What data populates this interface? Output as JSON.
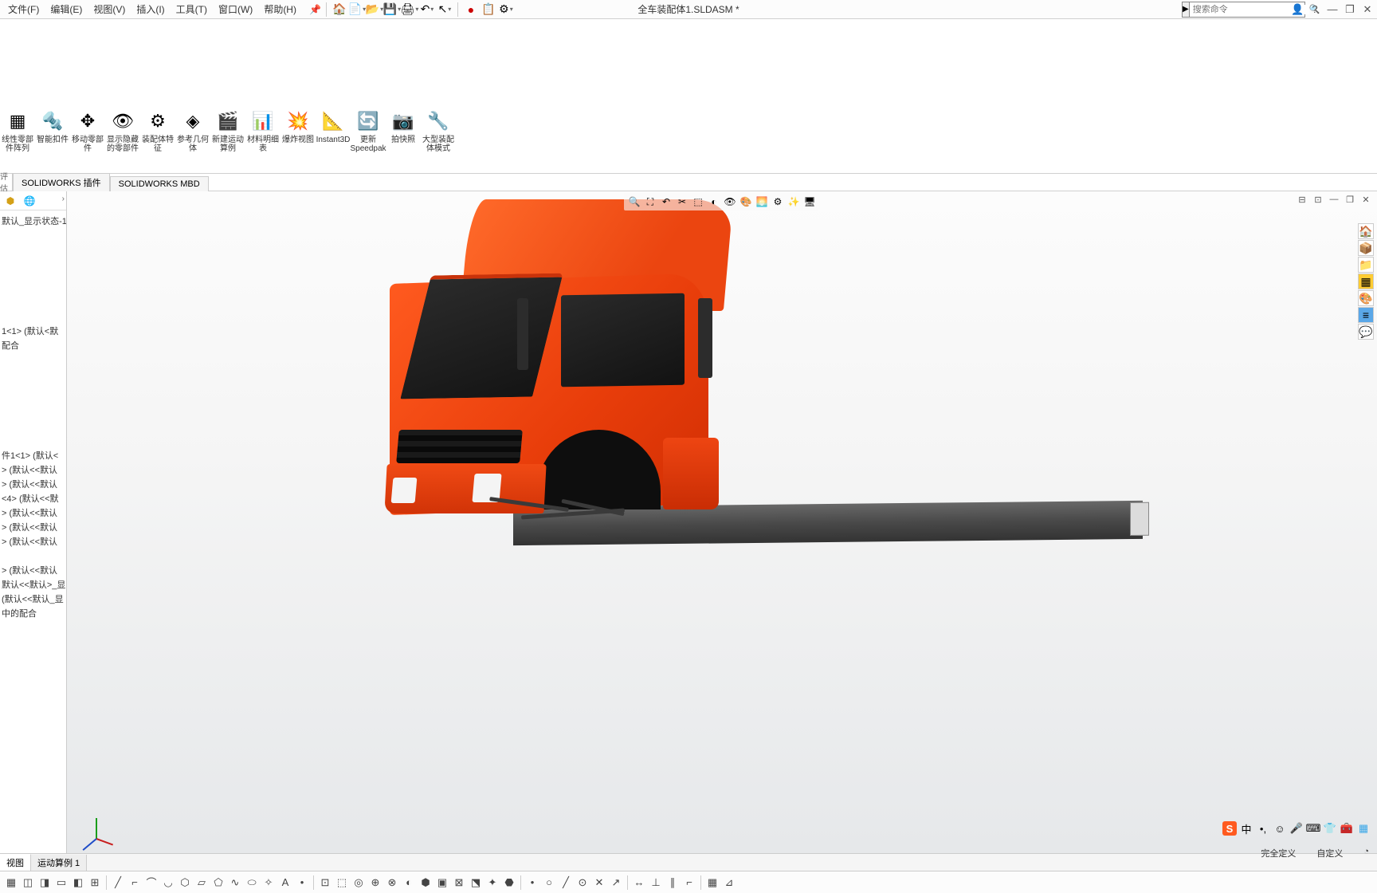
{
  "menu": {
    "items": [
      "文件(F)",
      "编辑(E)",
      "视图(V)",
      "插入(I)",
      "工具(T)",
      "窗口(W)",
      "帮助(H)"
    ]
  },
  "title": "全车装配体1.SLDASM *",
  "search": {
    "placeholder": "搜索命令"
  },
  "ribbon": {
    "items": [
      {
        "label": "线性零部件阵列"
      },
      {
        "label": "智能扣件"
      },
      {
        "label": "移动零部件"
      },
      {
        "label": "显示隐藏的零部件"
      },
      {
        "label": "装配体特征"
      },
      {
        "label": "参考几何体"
      },
      {
        "label": "新建运动算例"
      },
      {
        "label": "材料明细表"
      },
      {
        "label": "爆炸视图"
      },
      {
        "label": "Instant3D"
      },
      {
        "label": "更新Speedpak"
      },
      {
        "label": "拍快照"
      },
      {
        "label": "大型装配体模式"
      }
    ]
  },
  "appTabs": {
    "left": "评估",
    "items": [
      "SOLIDWORKS 插件",
      "SOLIDWORKS MBD"
    ]
  },
  "tree": {
    "state": "默认_显示状态-1",
    "items": [
      "1<1> (默认<默",
      "配合",
      "件1<1> (默认<",
      "> (默认<<默认",
      "> (默认<<默认",
      "<4> (默认<<默",
      "> (默认<<默认",
      "> (默认<<默认",
      "> (默认<<默认",
      "> (默认<<默认",
      "默认<<默认>_显",
      "(默认<<默认_显",
      "中的配合"
    ]
  },
  "bottomTabs": {
    "items": [
      "视图",
      "运动算例 1"
    ]
  },
  "status": {
    "left": "完全定义",
    "right": "自定义"
  }
}
